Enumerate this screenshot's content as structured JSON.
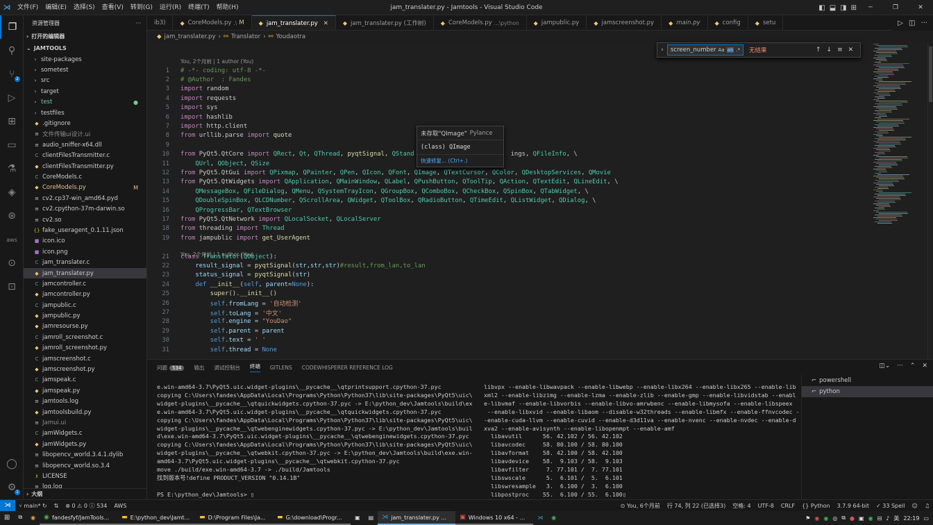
{
  "titlebar": {
    "title": "jam_translater.py - Jamtools - Visual Studio Code",
    "menu": [
      "文件(F)",
      "编辑(E)",
      "选择(S)",
      "查看(V)",
      "转到(G)",
      "运行(R)",
      "终端(T)",
      "帮助(H)"
    ]
  },
  "sidebar": {
    "header": "资源管理器",
    "open_editors": "打开的编辑器",
    "root": "JAMTOOLS",
    "items": [
      {
        "name": "site-packages",
        "icon": "›",
        "color": "#cccccc"
      },
      {
        "name": "sometest",
        "icon": "›",
        "color": "#cccccc"
      },
      {
        "name": "src",
        "icon": "›",
        "color": "#cccccc"
      },
      {
        "name": "target",
        "icon": "›",
        "color": "#cccccc"
      },
      {
        "name": "test",
        "icon": "›",
        "color": "#73c991",
        "tag": "●"
      },
      {
        "name": "testfiles",
        "icon": "›",
        "color": "#cccccc"
      },
      {
        "name": ".gitignore",
        "icon": "◆",
        "color": "#cccccc"
      },
      {
        "name": "文件传输ui设计.ui",
        "icon": "≡",
        "color": "#8c8c8c"
      },
      {
        "name": "audio_sniffer-x64.dll",
        "icon": "≡",
        "color": "#cccccc"
      },
      {
        "name": "clientFilesTransmitter.c",
        "icon": "C",
        "color": "#cccccc"
      },
      {
        "name": "clientFilesTransmitter.py",
        "icon": "◆",
        "color": "#cccccc"
      },
      {
        "name": "CoreModels.c",
        "icon": "C",
        "color": "#cccccc"
      },
      {
        "name": "CoreModels.py",
        "icon": "◆",
        "color": "#e2c08d",
        "tag": "M"
      },
      {
        "name": "cv2.cp37-win_amd64.pyd",
        "icon": "≡",
        "color": "#cccccc"
      },
      {
        "name": "cv2.cpython-37m-darwin.so",
        "icon": "≡",
        "color": "#cccccc"
      },
      {
        "name": "cv2.so",
        "icon": "≡",
        "color": "#cccccc"
      },
      {
        "name": "fake_useragent_0.1.11.json",
        "icon": "{}",
        "color": "#cccccc"
      },
      {
        "name": "icon.ico",
        "icon": "■",
        "color": "#cccccc"
      },
      {
        "name": "icon.png",
        "icon": "■",
        "color": "#cccccc"
      },
      {
        "name": "jam_translater.c",
        "icon": "C",
        "color": "#cccccc"
      },
      {
        "name": "jam_translater.py",
        "icon": "◆",
        "color": "#cccccc",
        "selected": true
      },
      {
        "name": "jamcontroller.c",
        "icon": "C",
        "color": "#cccccc"
      },
      {
        "name": "jamcontroller.py",
        "icon": "◆",
        "color": "#cccccc"
      },
      {
        "name": "jampublic.c",
        "icon": "C",
        "color": "#cccccc"
      },
      {
        "name": "jampublic.py",
        "icon": "◆",
        "color": "#cccccc"
      },
      {
        "name": "jamresourse.py",
        "icon": "◆",
        "color": "#cccccc"
      },
      {
        "name": "jamroll_screenshot.c",
        "icon": "C",
        "color": "#cccccc"
      },
      {
        "name": "jamroll_screenshot.py",
        "icon": "◆",
        "color": "#cccccc"
      },
      {
        "name": "jamscreenshot.c",
        "icon": "C",
        "color": "#cccccc"
      },
      {
        "name": "jamscreenshot.py",
        "icon": "◆",
        "color": "#cccccc"
      },
      {
        "name": "jamspeak.c",
        "icon": "C",
        "color": "#cccccc"
      },
      {
        "name": "jamspeak.py",
        "icon": "◆",
        "color": "#cccccc"
      },
      {
        "name": "jamtools.log",
        "icon": "≡",
        "color": "#cccccc"
      },
      {
        "name": "jamtoolsbuild.py",
        "icon": "◆",
        "color": "#cccccc"
      },
      {
        "name": "Jamui.ui",
        "icon": "≡",
        "color": "#8c8c8c"
      },
      {
        "name": "jamWidgets.c",
        "icon": "C",
        "color": "#cccccc"
      },
      {
        "name": "jamWidgets.py",
        "icon": "◆",
        "color": "#cccccc"
      },
      {
        "name": "libopencv_world.3.4.1.dylib",
        "icon": "≡",
        "color": "#cccccc"
      },
      {
        "name": "libopencv_world.so.3.4",
        "icon": "≡",
        "color": "#cccccc"
      },
      {
        "name": "LICENSE",
        "icon": "♗",
        "color": "#cccccc"
      },
      {
        "name": "log.log",
        "icon": "≡",
        "color": "#cccccc"
      }
    ],
    "outline": "大纲"
  },
  "tabs": [
    {
      "name": "ib3)",
      "sub": "",
      "mod": ""
    },
    {
      "name": "CoreModels.py",
      "sub": ".\\",
      "mod": "M"
    },
    {
      "name": "jam_translater.py",
      "sub": "",
      "mod": "",
      "active": true
    },
    {
      "name": "jam_translater.py (工作树)",
      "sub": "",
      "mod": ""
    },
    {
      "name": "CoreModels.py",
      "sub": "...\\python",
      "mod": ""
    },
    {
      "name": "jampublic.py",
      "sub": "",
      "mod": ""
    },
    {
      "name": "jamscreenshot.py",
      "sub": "",
      "mod": ""
    },
    {
      "name": "main.py",
      "sub": "",
      "mod": "",
      "italic": true
    },
    {
      "name": "config",
      "sub": "",
      "mod": ""
    },
    {
      "name": "setu",
      "sub": "",
      "mod": ""
    }
  ],
  "breadcrumb": [
    "jam_translater.py",
    "Translator",
    "Youdaotra"
  ],
  "codelens1": "You, 2个月前 | 1 author (You)",
  "codelens2": "You, 2个月前 | 1 author (You)",
  "code": [
    {
      "n": "1",
      "t": "# -*- coding: utf-8 -*-"
    },
    {
      "n": "2",
      "t": "# @Author  : Fandes"
    },
    {
      "n": "3",
      "t": "import random"
    },
    {
      "n": "4",
      "t": "import requests"
    },
    {
      "n": "5",
      "t": "import sys"
    },
    {
      "n": "6",
      "t": "import hashlib"
    },
    {
      "n": "7",
      "t": "import http.client"
    },
    {
      "n": "8",
      "t": "from urllib.parse import quote"
    },
    {
      "n": "9",
      "t": ""
    },
    {
      "n": "10",
      "t": "from PyQt5.QtCore import QRect, Qt, QThread, pyqtSignal, QStand                          ings, QFileInfo, \\"
    },
    {
      "n": "11",
      "t": "    QUrl, QObject, QSize"
    },
    {
      "n": "12",
      "t": "from PyQt5.QtGui import QPixmap, QPainter, QPen, QIcon, QFont, QImage, QTextCursor, QColor, QDesktopServices, QMovie"
    },
    {
      "n": "13",
      "t": "from PyQt5.QtWidgets import QApplication, QMainWindow, QLabel, QPushButton, QToolTip, QAction, QTextEdit, QLineEdit, \\"
    },
    {
      "n": "14",
      "t": "    QMessageBox, QFileDialog, QMenu, QSystemTrayIcon, QGroupBox, QComboBox, QCheckBox, QSpinBox, QTabWidget, \\"
    },
    {
      "n": "15",
      "t": "    QDoubleSpinBox, QLCDNumber, QScrollArea, QWidget, QToolBox, QRadioButton, QTimeEdit, QListWidget, QDialog, \\"
    },
    {
      "n": "16",
      "t": "    QProgressBar, QTextBrowser"
    },
    {
      "n": "17",
      "t": "from PyQt5.QtNetwork import QLocalSocket, QLocalServer"
    },
    {
      "n": "18",
      "t": "from threading import Thread"
    },
    {
      "n": "19",
      "t": "from jampublic import get_UserAgent"
    },
    {
      "n": "21",
      "t": "class Translator(QObject):"
    },
    {
      "n": "22",
      "t": "    result_signal = pyqtSignal(str,str,str)#result,from_lan,to_lan"
    },
    {
      "n": "23",
      "t": "    status_signal = pyqtSignal(str)"
    },
    {
      "n": "24",
      "t": "    def __init__(self, parent=None):"
    },
    {
      "n": "25",
      "t": "        super().__init__()"
    },
    {
      "n": "26",
      "t": "        self.fromLang = '自动检测'"
    },
    {
      "n": "27",
      "t": "        self.toLang = '中文'"
    },
    {
      "n": "28",
      "t": "        self.engine = \"YouDao\""
    },
    {
      "n": "29",
      "t": "        self.parent = parent"
    },
    {
      "n": "30",
      "t": "        self.text = ' '"
    },
    {
      "n": "31",
      "t": "        self.thread = None"
    }
  ],
  "find": {
    "value": "screen_number",
    "options": [
      "Aa",
      "ab",
      ".*"
    ],
    "result": "无结果"
  },
  "hover": {
    "title": "未存取\"QImage\"",
    "source": "Pylance",
    "signature": "(class) QImage",
    "quickfix": "快速修复... (Ctrl+.)"
  },
  "panel": {
    "tabs": [
      "问题",
      "输出",
      "调试控制台",
      "终端",
      "GITLENS",
      "CODEWHISPERER REFERENCE LOG"
    ],
    "problems_count": "534",
    "active_tab": "终端",
    "left_terminal": [
      "e.win-amd64-3.7\\PyQt5.uic.widget-plugins\\__pycache__\\qtprintsupport.cpython-37.pyc",
      "copying C:\\Users\\fandes\\AppData\\Local\\Programs\\Python\\Python37\\lib\\site-packages\\PyQt5\\uic\\",
      "widget-plugins\\__pycache__\\qtquickwidgets.cpython-37.pyc -> E:\\python_dev\\Jamtools\\build\\ex",
      "e.win-amd64-3.7\\PyQt5.uic.widget-plugins\\__pycache__\\qtquickwidgets.cpython-37.pyc",
      "copying C:\\Users\\fandes\\AppData\\Local\\Programs\\Python\\Python37\\lib\\site-packages\\PyQt5\\uic\\",
      "widget-plugins\\__pycache__\\qtwebenginewidgets.cpython-37.pyc -> E:\\python_dev\\Jamtools\\buil",
      "d\\exe.win-amd64-3.7\\PyQt5.uic.widget-plugins\\__pycache__\\qtwebenginewidgets.cpython-37.pyc",
      "copying C:\\Users\\fandes\\AppData\\Local\\Programs\\Python\\Python37\\lib\\site-packages\\PyQt5\\uic\\",
      "widget-plugins\\__pycache__\\qtwebkit.cpython-37.pyc -> E:\\python_dev\\Jamtools\\build\\exe.win-",
      "amd64-3.7\\PyQt5.uic.widget-plugins\\__pycache__\\qtwebkit.cpython-37.pyc",
      "move ./build/exe.win-amd64-3.7 -> ./build/Jamtools",
      "找到版本号!define PRODUCT_VERSION \"0.14.1B\"",
      "",
      "PS E:\\python_dev\\Jamtools> ▯"
    ],
    "right_terminal": [
      "libvpx --enable-libwavpack --enable-libwebp --enable-libx264 --enable-libx265 --enable-lib",
      "xml2 --enable-libzimg --enable-lzma --enable-zlib --enable-gmp --enable-libvidstab --enabl",
      "e-libvmaf --enable-libvorbis --enable-libvo-amrwbenc --enable-libmysofa --enable-libspeex",
      " --enable-libxvid --enable-libaom --disable-w32threads --enable-libmfx --enable-ffnvcodec -",
      "-enable-cuda-llvm --enable-cuvid --enable-d3d11va --enable-nvenc --enable-nvdec --enable-d",
      "xva2 --enable-avisynth --enable-libopenmpt --enable-amf",
      "  libavutil      56. 42.102 / 56. 42.102",
      "  libavcodec     58. 80.100 / 58. 80.100",
      "  libavformat    58. 42.100 / 58. 42.100",
      "  libavdevice    58.  9.103 / 58.  9.103",
      "  libavfilter     7. 77.101 /  7. 77.101",
      "  libswscale      5.  6.101 /  5.  6.101",
      "  libswresample   3.  6.100 /  3.  6.100",
      "  libpostproc    55.  6.100 / 55.  6.100▯"
    ],
    "terminals": [
      "powershell",
      "python"
    ]
  },
  "statusbar": {
    "branch": "main*",
    "errors": "0",
    "warnings": "0",
    "info": "534",
    "aws": "AWS",
    "blame": "You, 6个月前",
    "position": "行 74, 列 22 (已选择3)",
    "spaces": "空格: 4",
    "encoding": "UTF-8",
    "eol": "CRLF",
    "language": "Python",
    "interpreter": "3.7.9 64-bit",
    "spell": "33 Spell"
  },
  "taskbar": {
    "apps": [
      "fandesfyf/JamTools...",
      "E:\\python_dev\\Jamt...",
      "D:\\Program Files\\Ja...",
      "G:\\download\\Progr...",
      "jam_translater.py ...",
      "Windows 10 x64 - ..."
    ],
    "ime": "英",
    "time": "22:19"
  },
  "colors": {
    "accent": "#0078d4",
    "modified": "#e2c08d",
    "git_added": "#73c991"
  }
}
